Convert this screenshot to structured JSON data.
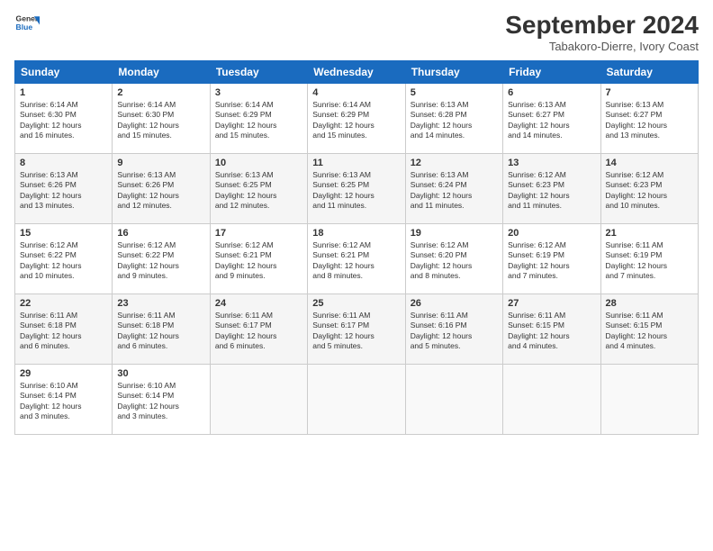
{
  "header": {
    "logo_line1": "General",
    "logo_line2": "Blue",
    "month": "September 2024",
    "location": "Tabakoro-Dierre, Ivory Coast"
  },
  "weekdays": [
    "Sunday",
    "Monday",
    "Tuesday",
    "Wednesday",
    "Thursday",
    "Friday",
    "Saturday"
  ],
  "weeks": [
    [
      {
        "day": "1",
        "sunrise": "Sunrise: 6:14 AM",
        "sunset": "Sunset: 6:30 PM",
        "daylight": "Daylight: 12 hours and 16 minutes."
      },
      {
        "day": "2",
        "sunrise": "Sunrise: 6:14 AM",
        "sunset": "Sunset: 6:30 PM",
        "daylight": "Daylight: 12 hours and 15 minutes."
      },
      {
        "day": "3",
        "sunrise": "Sunrise: 6:14 AM",
        "sunset": "Sunset: 6:29 PM",
        "daylight": "Daylight: 12 hours and 15 minutes."
      },
      {
        "day": "4",
        "sunrise": "Sunrise: 6:14 AM",
        "sunset": "Sunset: 6:29 PM",
        "daylight": "Daylight: 12 hours and 15 minutes."
      },
      {
        "day": "5",
        "sunrise": "Sunrise: 6:13 AM",
        "sunset": "Sunset: 6:28 PM",
        "daylight": "Daylight: 12 hours and 14 minutes."
      },
      {
        "day": "6",
        "sunrise": "Sunrise: 6:13 AM",
        "sunset": "Sunset: 6:27 PM",
        "daylight": "Daylight: 12 hours and 14 minutes."
      },
      {
        "day": "7",
        "sunrise": "Sunrise: 6:13 AM",
        "sunset": "Sunset: 6:27 PM",
        "daylight": "Daylight: 12 hours and 13 minutes."
      }
    ],
    [
      {
        "day": "8",
        "sunrise": "Sunrise: 6:13 AM",
        "sunset": "Sunset: 6:26 PM",
        "daylight": "Daylight: 12 hours and 13 minutes."
      },
      {
        "day": "9",
        "sunrise": "Sunrise: 6:13 AM",
        "sunset": "Sunset: 6:26 PM",
        "daylight": "Daylight: 12 hours and 12 minutes."
      },
      {
        "day": "10",
        "sunrise": "Sunrise: 6:13 AM",
        "sunset": "Sunset: 6:25 PM",
        "daylight": "Daylight: 12 hours and 12 minutes."
      },
      {
        "day": "11",
        "sunrise": "Sunrise: 6:13 AM",
        "sunset": "Sunset: 6:25 PM",
        "daylight": "Daylight: 12 hours and 11 minutes."
      },
      {
        "day": "12",
        "sunrise": "Sunrise: 6:13 AM",
        "sunset": "Sunset: 6:24 PM",
        "daylight": "Daylight: 12 hours and 11 minutes."
      },
      {
        "day": "13",
        "sunrise": "Sunrise: 6:12 AM",
        "sunset": "Sunset: 6:23 PM",
        "daylight": "Daylight: 12 hours and 11 minutes."
      },
      {
        "day": "14",
        "sunrise": "Sunrise: 6:12 AM",
        "sunset": "Sunset: 6:23 PM",
        "daylight": "Daylight: 12 hours and 10 minutes."
      }
    ],
    [
      {
        "day": "15",
        "sunrise": "Sunrise: 6:12 AM",
        "sunset": "Sunset: 6:22 PM",
        "daylight": "Daylight: 12 hours and 10 minutes."
      },
      {
        "day": "16",
        "sunrise": "Sunrise: 6:12 AM",
        "sunset": "Sunset: 6:22 PM",
        "daylight": "Daylight: 12 hours and 9 minutes."
      },
      {
        "day": "17",
        "sunrise": "Sunrise: 6:12 AM",
        "sunset": "Sunset: 6:21 PM",
        "daylight": "Daylight: 12 hours and 9 minutes."
      },
      {
        "day": "18",
        "sunrise": "Sunrise: 6:12 AM",
        "sunset": "Sunset: 6:21 PM",
        "daylight": "Daylight: 12 hours and 8 minutes."
      },
      {
        "day": "19",
        "sunrise": "Sunrise: 6:12 AM",
        "sunset": "Sunset: 6:20 PM",
        "daylight": "Daylight: 12 hours and 8 minutes."
      },
      {
        "day": "20",
        "sunrise": "Sunrise: 6:12 AM",
        "sunset": "Sunset: 6:19 PM",
        "daylight": "Daylight: 12 hours and 7 minutes."
      },
      {
        "day": "21",
        "sunrise": "Sunrise: 6:11 AM",
        "sunset": "Sunset: 6:19 PM",
        "daylight": "Daylight: 12 hours and 7 minutes."
      }
    ],
    [
      {
        "day": "22",
        "sunrise": "Sunrise: 6:11 AM",
        "sunset": "Sunset: 6:18 PM",
        "daylight": "Daylight: 12 hours and 6 minutes."
      },
      {
        "day": "23",
        "sunrise": "Sunrise: 6:11 AM",
        "sunset": "Sunset: 6:18 PM",
        "daylight": "Daylight: 12 hours and 6 minutes."
      },
      {
        "day": "24",
        "sunrise": "Sunrise: 6:11 AM",
        "sunset": "Sunset: 6:17 PM",
        "daylight": "Daylight: 12 hours and 6 minutes."
      },
      {
        "day": "25",
        "sunrise": "Sunrise: 6:11 AM",
        "sunset": "Sunset: 6:17 PM",
        "daylight": "Daylight: 12 hours and 5 minutes."
      },
      {
        "day": "26",
        "sunrise": "Sunrise: 6:11 AM",
        "sunset": "Sunset: 6:16 PM",
        "daylight": "Daylight: 12 hours and 5 minutes."
      },
      {
        "day": "27",
        "sunrise": "Sunrise: 6:11 AM",
        "sunset": "Sunset: 6:15 PM",
        "daylight": "Daylight: 12 hours and 4 minutes."
      },
      {
        "day": "28",
        "sunrise": "Sunrise: 6:11 AM",
        "sunset": "Sunset: 6:15 PM",
        "daylight": "Daylight: 12 hours and 4 minutes."
      }
    ],
    [
      {
        "day": "29",
        "sunrise": "Sunrise: 6:10 AM",
        "sunset": "Sunset: 6:14 PM",
        "daylight": "Daylight: 12 hours and 3 minutes."
      },
      {
        "day": "30",
        "sunrise": "Sunrise: 6:10 AM",
        "sunset": "Sunset: 6:14 PM",
        "daylight": "Daylight: 12 hours and 3 minutes."
      },
      null,
      null,
      null,
      null,
      null
    ]
  ]
}
